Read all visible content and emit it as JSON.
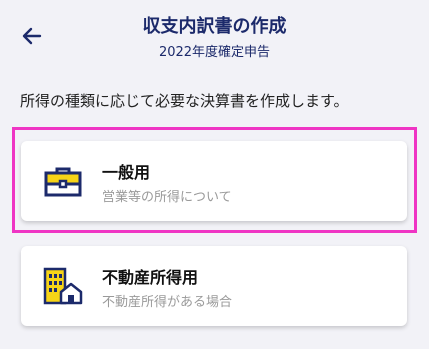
{
  "header": {
    "title": "収支内訳書の作成",
    "subtitle": "2022年度確定申告"
  },
  "description": "所得の種類に応じて必要な決算書を作成します。",
  "options": [
    {
      "title": "一般用",
      "desc": "営業等の所得について",
      "icon": "briefcase-icon"
    },
    {
      "title": "不動産所得用",
      "desc": "不動産所得がある場合",
      "icon": "building-house-icon"
    }
  ],
  "colors": {
    "accent": "#1c2a6b",
    "highlight": "#ef35c4",
    "icon_yellow": "#f7d417"
  }
}
